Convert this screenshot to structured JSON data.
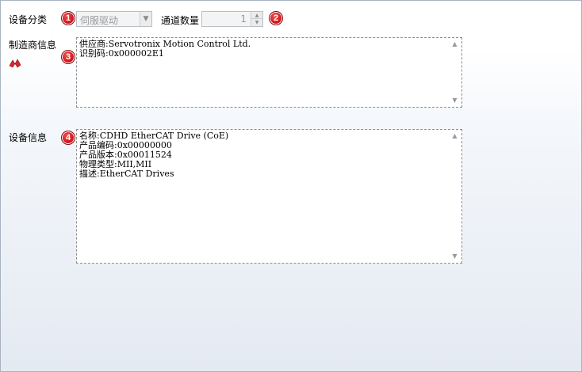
{
  "device_category": {
    "label": "设备分类",
    "badge": "1",
    "selected": "伺服驱动"
  },
  "channel_count": {
    "label": "通道数量",
    "badge": "2",
    "value": "1"
  },
  "manufacturer_info": {
    "label": "制造商信息",
    "badge": "3",
    "lines": [
      "供应商:Servotronix Motion Control Ltd.",
      "识别码:0x000002E1"
    ]
  },
  "device_info": {
    "label": "设备信息",
    "badge": "4",
    "lines": [
      "名称:CDHD EtherCAT Drive (CoE)",
      "产品编码:0x00000000",
      "产品版本:0x00011524",
      "物理类型:MII,MII",
      "描述:EtherCAT Drives"
    ]
  },
  "colors": {
    "badge": "#d8181e",
    "panel_border": "#a9b3c1",
    "memo_border": "#8c8c8c"
  },
  "icons": {
    "side_icon": "red-motion-icon"
  }
}
